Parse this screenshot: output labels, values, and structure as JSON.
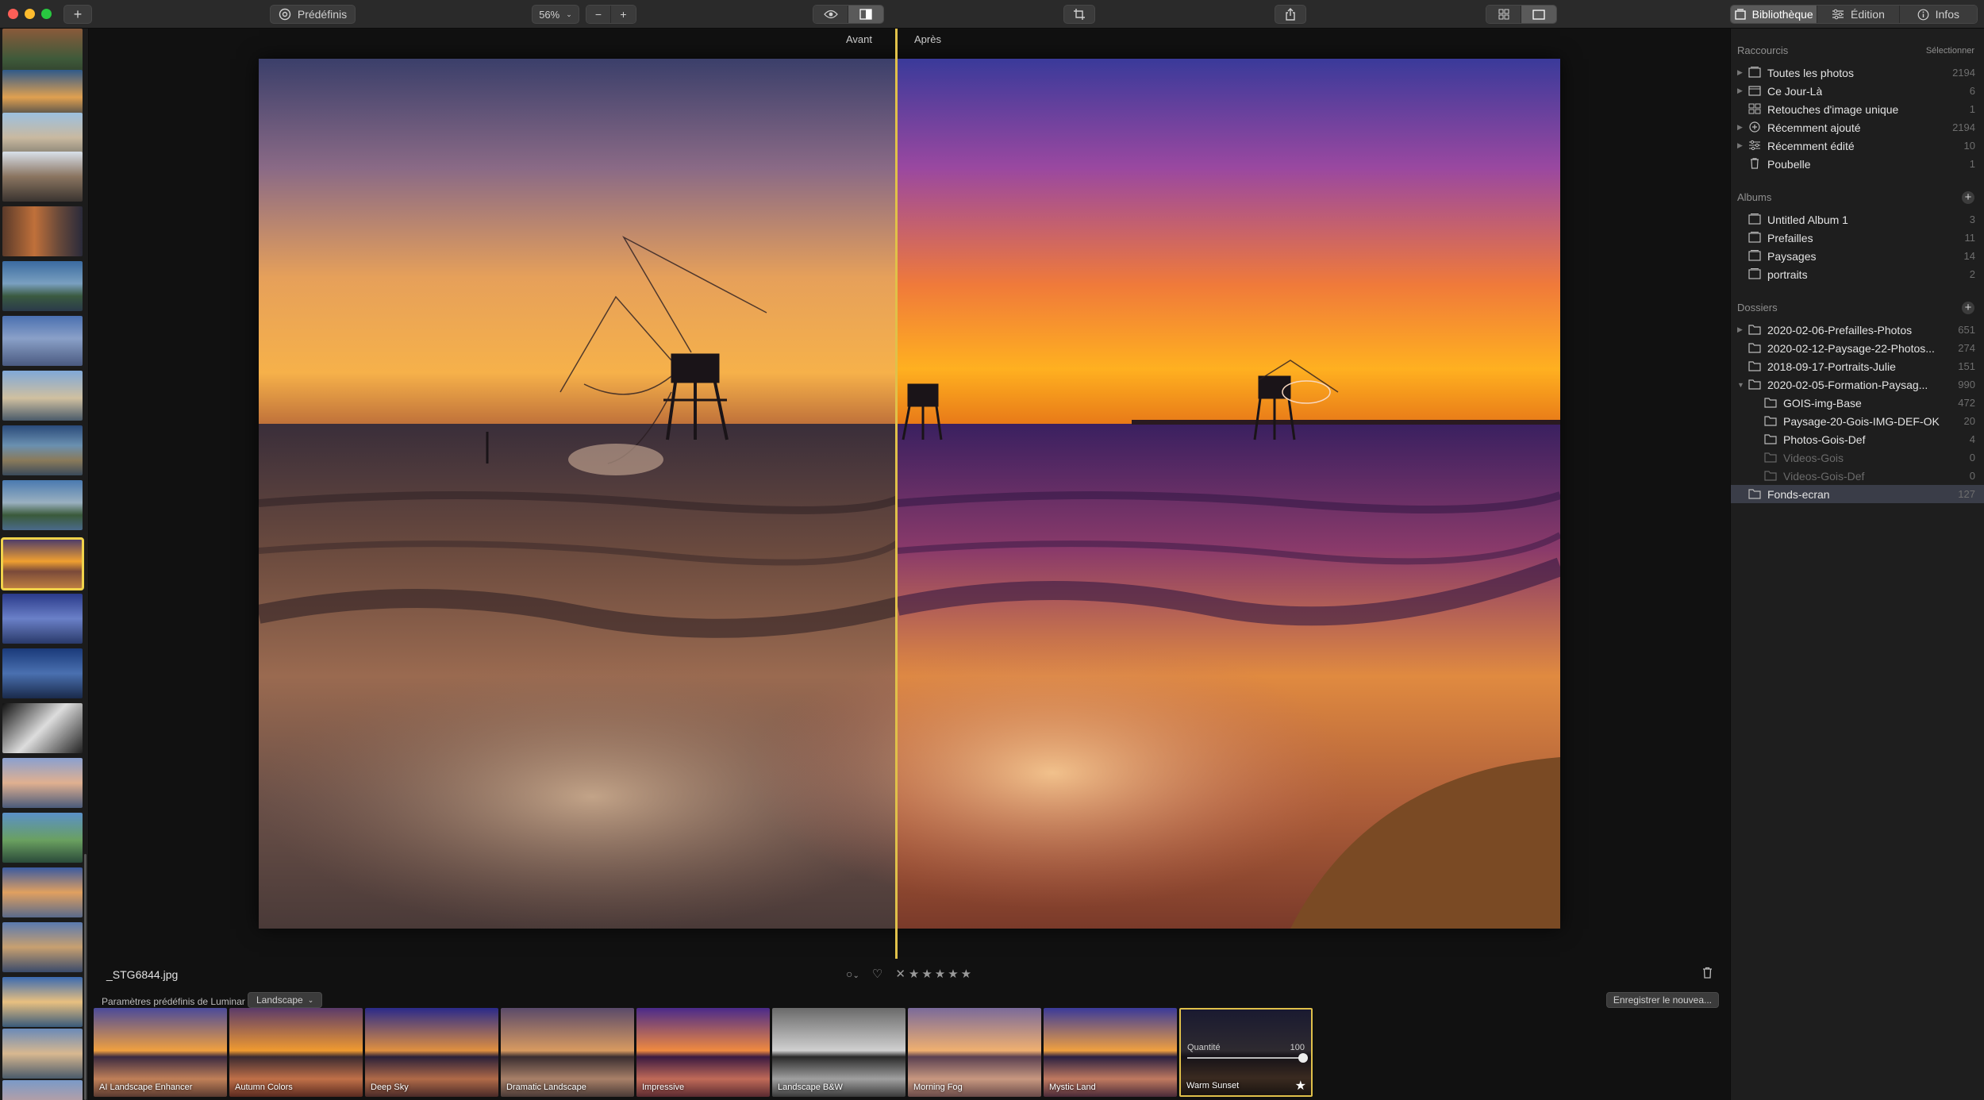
{
  "toolbar": {
    "presets_label": "Prédéfinis",
    "zoom": "56%",
    "zoom_out": "−",
    "zoom_in": "+",
    "library_label": "Bibliothèque",
    "edit_label": "Édition",
    "info_label": "Infos"
  },
  "compare": {
    "before": "Avant",
    "after": "Après"
  },
  "photo": {
    "filename": "_STG6844.jpg"
  },
  "rating": {
    "reject": "✕",
    "stars": "★★★★★"
  },
  "presets": {
    "title": "Paramètres prédéfinis de Luminar :",
    "category": "Landscape",
    "save": "Enregistrer le nouvea...",
    "items": [
      {
        "label": "AI Landscape Enhancer"
      },
      {
        "label": "Autumn Colors"
      },
      {
        "label": "Deep Sky"
      },
      {
        "label": "Dramatic Landscape"
      },
      {
        "label": "Impressive"
      },
      {
        "label": "Landscape B&W"
      },
      {
        "label": "Morning Fog"
      },
      {
        "label": "Mystic Land"
      },
      {
        "label": "Warm Sunset"
      }
    ],
    "amount_label": "Quantité",
    "amount_value": "100"
  },
  "sidebar": {
    "shortcuts_title": "Raccourcis",
    "select_label": "Sélectionner",
    "shortcuts": [
      {
        "label": "Toutes les photos",
        "count": "2194"
      },
      {
        "label": "Ce Jour-Là",
        "count": "6"
      },
      {
        "label": "Retouches d'image unique",
        "count": "1"
      },
      {
        "label": "Récemment ajouté",
        "count": "2194"
      },
      {
        "label": "Récemment édité",
        "count": "10"
      },
      {
        "label": "Poubelle",
        "count": "1"
      }
    ],
    "albums_title": "Albums",
    "albums": [
      {
        "label": "Untitled Album 1",
        "count": "3"
      },
      {
        "label": "Prefailles",
        "count": "11"
      },
      {
        "label": "Paysages",
        "count": "14"
      },
      {
        "label": "portraits",
        "count": "2"
      }
    ],
    "folders_title": "Dossiers",
    "folders": [
      {
        "label": "2020-02-06-Prefailles-Photos",
        "count": "651"
      },
      {
        "label": "2020-02-12-Paysage-22-Photos...",
        "count": "274"
      },
      {
        "label": "2018-09-17-Portraits-Julie",
        "count": "151"
      },
      {
        "label": "2020-02-05-Formation-Paysag...",
        "count": "990"
      },
      {
        "label": "GOIS-img-Base",
        "count": "472"
      },
      {
        "label": "Paysage-20-Gois-IMG-DEF-OK",
        "count": "20"
      },
      {
        "label": "Photos-Gois-Def",
        "count": "4"
      },
      {
        "label": "Videos-Gois",
        "count": "0"
      },
      {
        "label": "Videos-Gois-Def",
        "count": "0"
      },
      {
        "label": "Fonds-ecran",
        "count": "127"
      }
    ]
  }
}
